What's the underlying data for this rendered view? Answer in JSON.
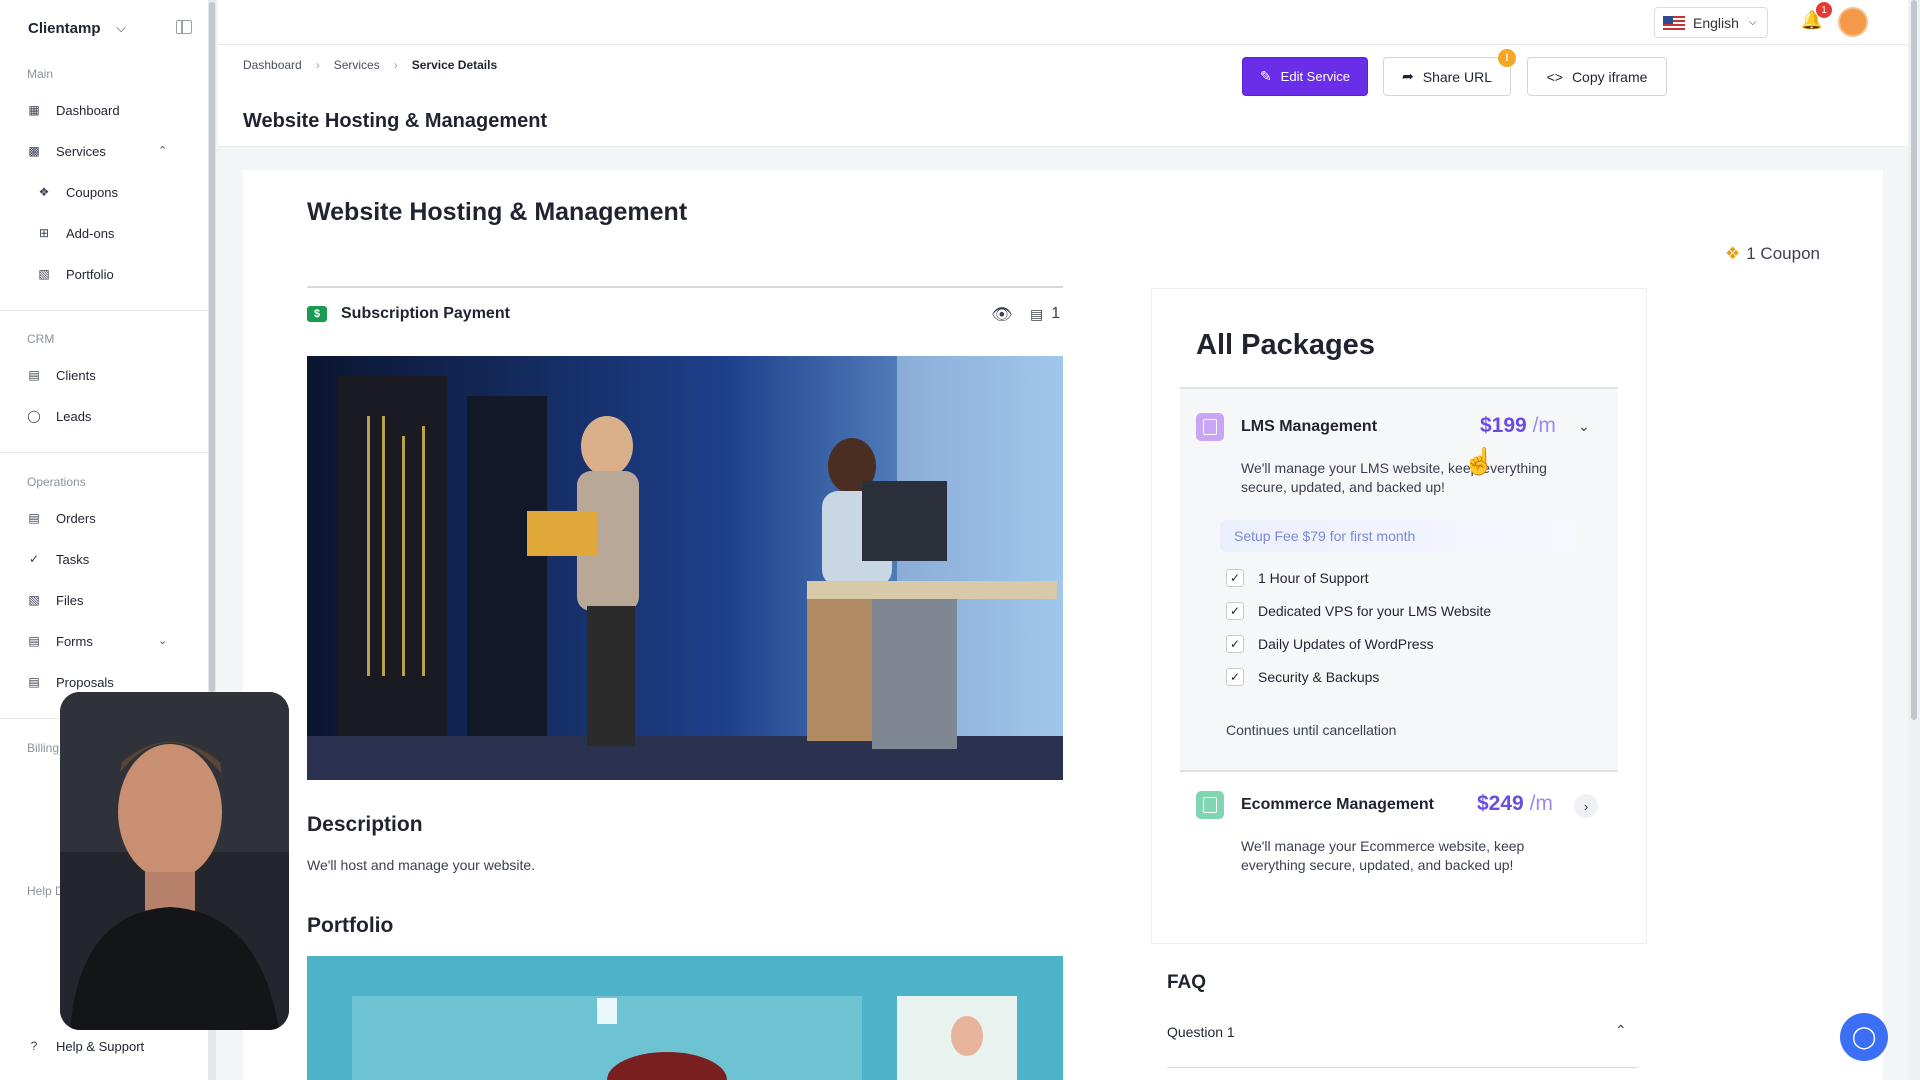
{
  "sidebar": {
    "brand": "Clientamp",
    "sections": {
      "main": "Main",
      "crm": "CRM",
      "operations": "Operations",
      "billing": "Billing",
      "help": "Help D"
    },
    "items": {
      "dashboard": "Dashboard",
      "services": "Services",
      "coupons": "Coupons",
      "addons": "Add-ons",
      "portfolio": "Portfolio",
      "clients": "Clients",
      "leads": "Leads",
      "orders": "Orders",
      "tasks": "Tasks",
      "files": "Files",
      "forms": "Forms",
      "proposals": "Proposals",
      "help_support": "Help & Support"
    }
  },
  "topbar": {
    "language": "English",
    "notifications_count": "1"
  },
  "breadcrumb": [
    "Dashboard",
    "Services",
    "Service Details"
  ],
  "page": {
    "title": "Website Hosting & Management",
    "buttons": {
      "edit": "Edit Service",
      "share": "Share URL",
      "copy": "Copy iframe"
    },
    "share_badge": "!"
  },
  "service": {
    "title": "Website Hosting & Management",
    "coupon": "1 Coupon",
    "payment_type": "Subscription Payment",
    "payment_count": "1",
    "description_heading": "Description",
    "description": "We'll host and manage your website.",
    "portfolio_heading": "Portfolio"
  },
  "packages": {
    "heading": "All Packages",
    "items": [
      {
        "name": "LMS Management",
        "price": "$199",
        "period": "/m",
        "description": "We'll manage your LMS website, keep everything secure, updated, and backed up!",
        "setup_fee": "Setup Fee $79 for first month",
        "features": [
          "1 Hour of Support",
          "Dedicated VPS for your LMS Website",
          "Daily Updates of WordPress",
          "Security & Backups"
        ],
        "billing_note": "Continues until cancellation",
        "icon_color": "#c9a6f5",
        "expanded": true
      },
      {
        "name": "Ecommerce Management",
        "price": "$249",
        "period": "/m",
        "description": "We'll manage your Ecommerce website, keep everything secure, updated, and backed up!",
        "icon_color": "#7fd6b0",
        "expanded": false
      }
    ]
  },
  "faq": {
    "heading": "FAQ",
    "questions": [
      "Question 1"
    ]
  },
  "colors": {
    "accent": "#6b2ee8",
    "price": "#6b4ce0",
    "chat": "#3b6ff5"
  }
}
